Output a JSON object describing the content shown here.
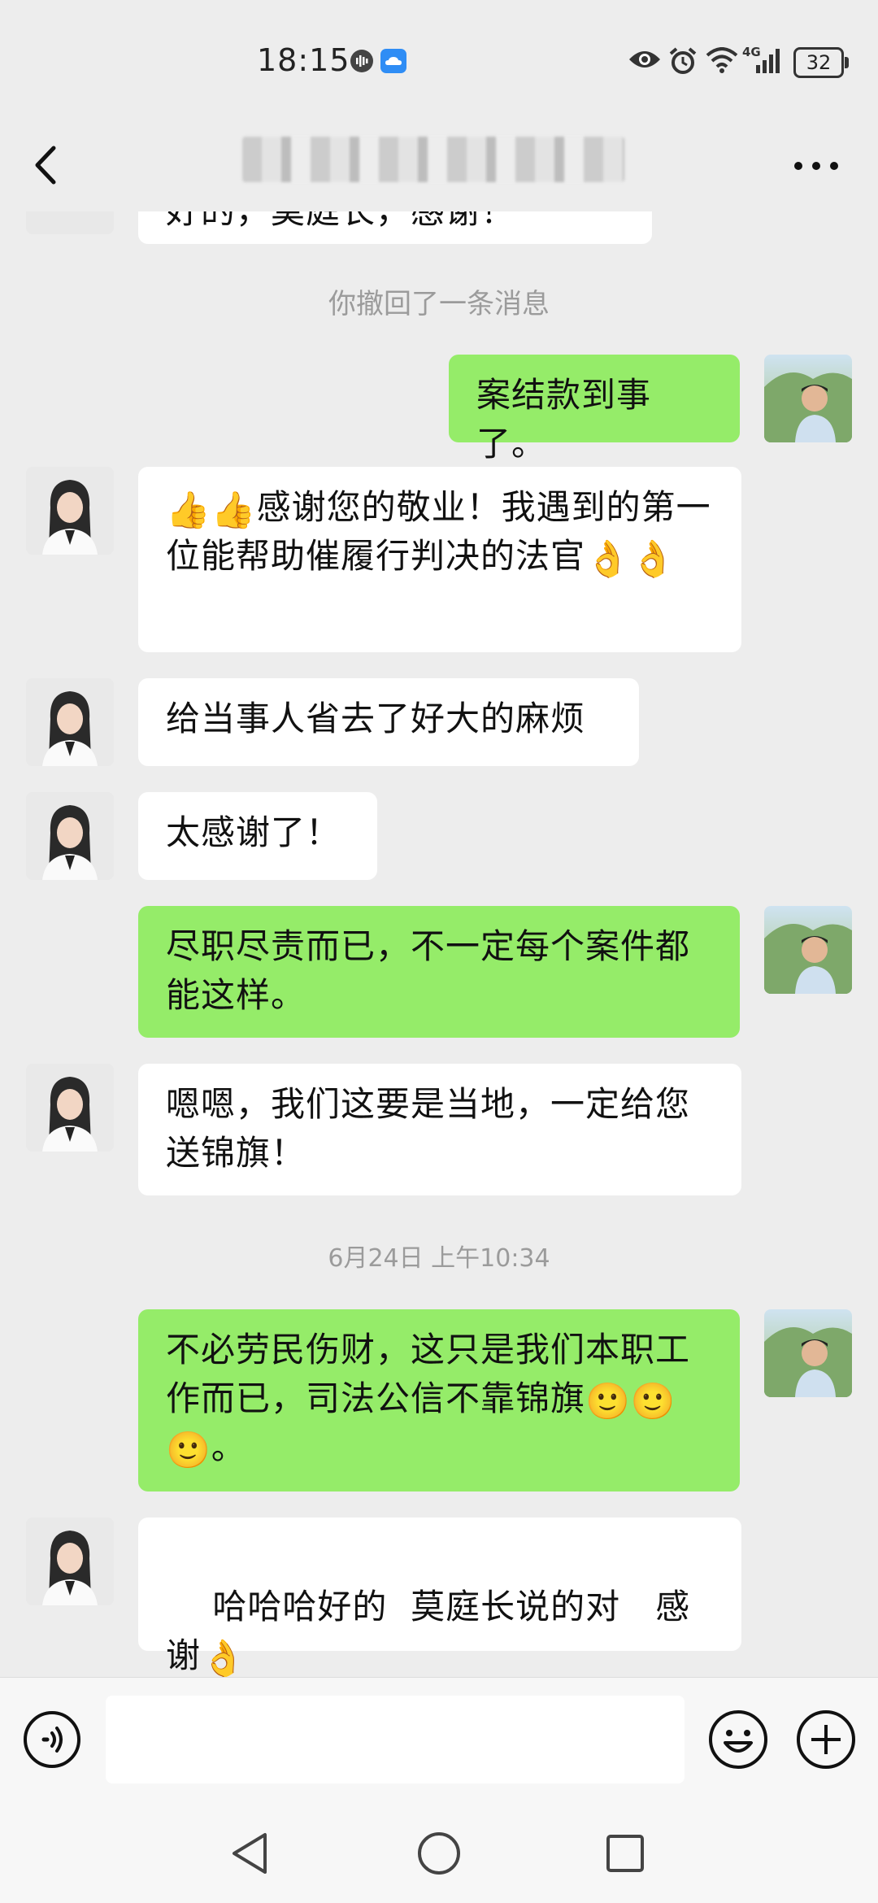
{
  "status_bar": {
    "time": "18:15",
    "network": "4G",
    "battery": "32"
  },
  "title_bar": {
    "title": ""
  },
  "chat": {
    "partial_top_text": "好的，莫庭长，感谢！",
    "recall_notice": "你撤回了一条消息",
    "messages": [
      {
        "from": "me",
        "text": "案结款到事了。"
      },
      {
        "from": "them",
        "text": "感谢您的敬业！我遇到的第一位能帮助催履行判决的法官"
      },
      {
        "from": "them",
        "text": "给当事人省去了好大的麻烦"
      },
      {
        "from": "them",
        "text": "太感谢了！"
      },
      {
        "from": "me",
        "text": "尽职尽责而已，不一定每个案件都能这样。"
      },
      {
        "from": "them",
        "text": "嗯嗯，我们这要是当地，一定给您送锦旗！"
      },
      {
        "from": "me",
        "text": "不必劳民伤财，这只是我们本职工作而已，司法公信不靠锦旗"
      },
      {
        "from": "them",
        "text": "哈哈哈好的  莫庭长说的对   感谢"
      }
    ],
    "timestamp": "6月24日 上午10:34",
    "emojis": {
      "thumbs_up": "👍",
      "ok_hand": "👌",
      "smile": "🙂"
    },
    "punct_period": "。"
  },
  "input_bar": {
    "placeholder": ""
  },
  "colors": {
    "background": "#ededed",
    "outgoing_bubble": "#95ec69",
    "incoming_bubble": "#ffffff"
  }
}
